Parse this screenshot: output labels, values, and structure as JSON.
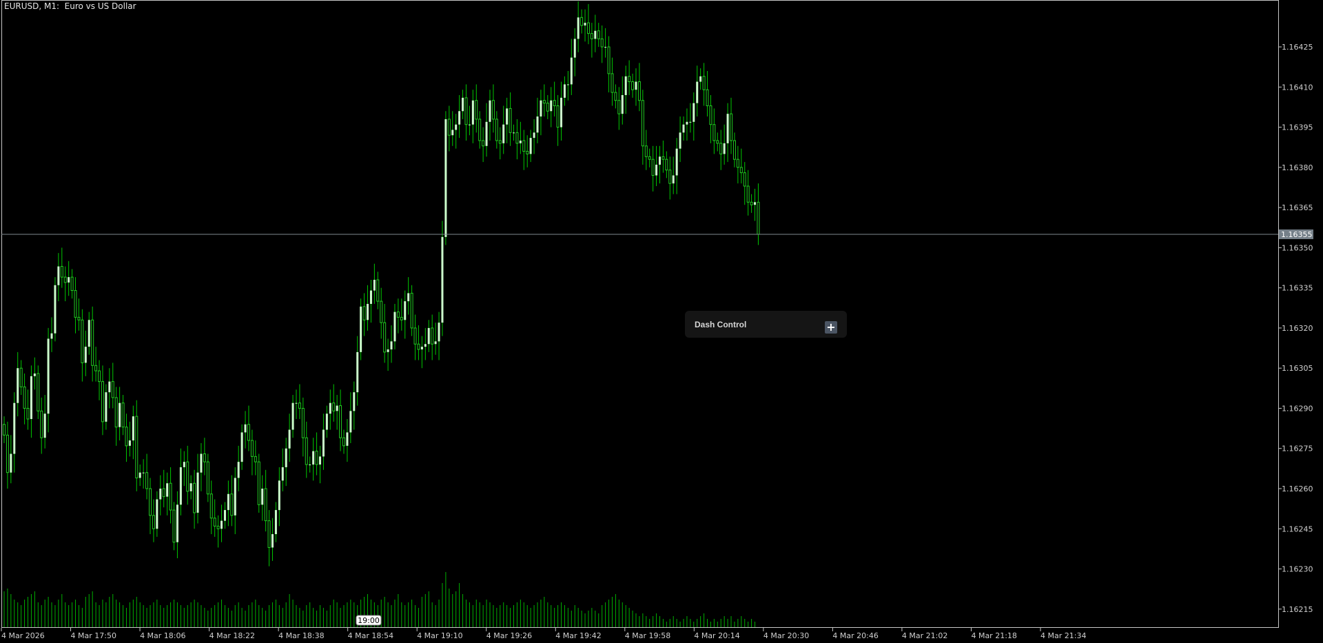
{
  "window": {
    "title": "EURUSD, M1:  Euro vs US Dollar"
  },
  "dash_control": {
    "title": "Dash Control",
    "button_icon": "plus-icon",
    "button_symbol": "+"
  },
  "colors": {
    "background": "#000000",
    "axis": "#c8c8c8",
    "candle_bull": "#ccffcc",
    "candle_bear_outline": "#22cc22",
    "wick": "#00c800",
    "volume": "#00b000",
    "bid_line": "#7f8a8f",
    "bid_label_bg": "#758089"
  },
  "chart_data": {
    "type": "candlestick",
    "symbol": "EURUSD",
    "timeframe": "M1",
    "current_price_label": "1.16355",
    "current_price": 1.16355,
    "ylim": [
      1.16208,
      1.16442
    ],
    "y_ticks": [
      "1.16425",
      "1.16410",
      "1.16395",
      "1.16380",
      "1.16365",
      "1.16350",
      "1.16335",
      "1.16320",
      "1.16305",
      "1.16290",
      "1.16275",
      "1.16260",
      "1.16245",
      "1.16230",
      "1.16215"
    ],
    "x_ticks": [
      "4 Mar 2026",
      "4 Mar 17:50",
      "4 Mar 18:06",
      "4 Mar 18:22",
      "4 Mar 18:38",
      "4 Mar 18:54",
      "4 Mar 19:10",
      "4 Mar 19:26",
      "4 Mar 19:42",
      "4 Mar 19:58",
      "4 Mar 20:14",
      "4 Mar 20:30",
      "4 Mar 20:46",
      "4 Mar 21:02",
      "4 Mar 21:18",
      "4 Mar 21:34"
    ],
    "time_marker_label": "19:00",
    "close_series": [
      1.1628,
      1.16266,
      1.16273,
      1.16292,
      1.16305,
      1.16298,
      1.1629,
      1.16286,
      1.16302,
      1.16303,
      1.16289,
      1.16279,
      1.16288,
      1.16316,
      1.16318,
      1.16336,
      1.16343,
      1.16339,
      1.16337,
      1.16339,
      1.16334,
      1.16324,
      1.16323,
      1.16307,
      1.16313,
      1.16323,
      1.16306,
      1.16304,
      1.163,
      1.16285,
      1.16296,
      1.163,
      1.16294,
      1.16283,
      1.16292,
      1.16283,
      1.16276,
      1.16278,
      1.16287,
      1.16264,
      1.16266,
      1.16266,
      1.1626,
      1.1625,
      1.16245,
      1.16256,
      1.1626,
      1.16257,
      1.16262,
      1.16252,
      1.1624,
      1.16254,
      1.16268,
      1.1627,
      1.16259,
      1.16262,
      1.16251,
      1.16266,
      1.16273,
      1.1627,
      1.16258,
      1.16249,
      1.16246,
      1.16245,
      1.16248,
      1.16252,
      1.16258,
      1.1625,
      1.16264,
      1.1627,
      1.16281,
      1.16284,
      1.16278,
      1.16272,
      1.1627,
      1.16254,
      1.1626,
      1.16248,
      1.16238,
      1.16243,
      1.16252,
      1.16263,
      1.16268,
      1.16275,
      1.16282,
      1.16292,
      1.16292,
      1.1629,
      1.16279,
      1.16269,
      1.16269,
      1.16274,
      1.16269,
      1.16272,
      1.16282,
      1.16288,
      1.16292,
      1.16289,
      1.16291,
      1.16279,
      1.16276,
      1.16281,
      1.16289,
      1.16296,
      1.16311,
      1.16328,
      1.16323,
      1.16329,
      1.16334,
      1.16338,
      1.1633,
      1.16322,
      1.16311,
      1.16312,
      1.16315,
      1.16326,
      1.16324,
      1.16323,
      1.1633,
      1.16333,
      1.1632,
      1.16314,
      1.16312,
      1.16313,
      1.16314,
      1.1632,
      1.16314,
      1.16315,
      1.16322,
      1.16354,
      1.16398,
      1.16392,
      1.16394,
      1.16396,
      1.16401,
      1.16406,
      1.16396,
      1.16396,
      1.16405,
      1.16398,
      1.1639,
      1.16388,
      1.16397,
      1.16405,
      1.16398,
      1.1639,
      1.16389,
      1.16396,
      1.16402,
      1.16393,
      1.16393,
      1.16389,
      1.1639,
      1.16386,
      1.16385,
      1.16391,
      1.16393,
      1.16399,
      1.16405,
      1.16404,
      1.16401,
      1.16405,
      1.16403,
      1.16395,
      1.16406,
      1.16411,
      1.16411,
      1.16421,
      1.16428,
      1.16436,
      1.16433,
      1.16434,
      1.1643,
      1.16428,
      1.16431,
      1.16428,
      1.16425,
      1.16425,
      1.16415,
      1.16408,
      1.16405,
      1.164,
      1.16407,
      1.16414,
      1.16412,
      1.16409,
      1.16412,
      1.16405,
      1.16388,
      1.16384,
      1.16383,
      1.16377,
      1.16381,
      1.16384,
      1.16383,
      1.16379,
      1.16374,
      1.16377,
      1.16387,
      1.16393,
      1.16396,
      1.16397,
      1.16397,
      1.16404,
      1.16412,
      1.16414,
      1.16409,
      1.16403,
      1.16396,
      1.1639,
      1.16389,
      1.16385,
      1.16389,
      1.164,
      1.1639,
      1.16383,
      1.1638,
      1.16378,
      1.16373,
      1.16367,
      1.16366,
      1.16367,
      1.16355
    ],
    "volume_series": [
      13,
      14,
      12,
      10,
      9,
      8,
      10,
      11,
      12,
      13,
      9,
      8,
      10,
      11,
      9,
      8,
      10,
      12,
      9,
      8,
      9,
      10,
      8,
      7,
      11,
      12,
      13,
      9,
      8,
      10,
      9,
      11,
      12,
      10,
      9,
      8,
      7,
      9,
      10,
      11,
      9,
      8,
      7,
      8,
      9,
      10,
      8,
      7,
      8,
      9,
      10,
      9,
      8,
      7,
      8,
      9,
      10,
      9,
      8,
      7,
      6,
      7,
      8,
      9,
      10,
      8,
      7,
      6,
      8,
      9,
      7,
      6,
      8,
      9,
      10,
      8,
      7,
      6,
      8,
      9,
      10,
      8,
      7,
      9,
      12,
      10,
      8,
      7,
      6,
      8,
      9,
      7,
      6,
      8,
      7,
      6,
      8,
      10,
      9,
      7,
      8,
      9,
      10,
      9,
      8,
      10,
      11,
      12,
      10,
      9,
      8,
      10,
      11,
      9,
      8,
      10,
      12,
      9,
      8,
      9,
      10,
      8,
      7,
      11,
      12,
      13,
      9,
      8,
      10,
      16,
      20,
      14,
      12,
      13,
      16,
      12,
      10,
      9,
      8,
      10,
      9,
      8,
      10,
      9,
      8,
      7,
      8,
      9,
      8,
      7,
      8,
      9,
      10,
      9,
      8,
      7,
      8,
      9,
      10,
      11,
      9,
      8,
      7,
      8,
      9,
      8,
      7,
      6,
      8,
      7,
      6,
      5,
      6,
      7,
      6,
      5,
      8,
      9,
      10,
      11,
      12,
      10,
      9,
      8,
      7,
      6,
      5,
      4,
      5,
      4,
      3,
      4,
      5,
      4,
      3,
      2,
      3,
      4,
      3,
      2,
      3,
      4,
      3,
      2,
      3,
      4,
      5,
      3,
      2,
      3,
      2,
      3,
      4,
      3,
      4,
      2,
      3,
      4,
      3,
      2,
      3,
      2
    ]
  }
}
